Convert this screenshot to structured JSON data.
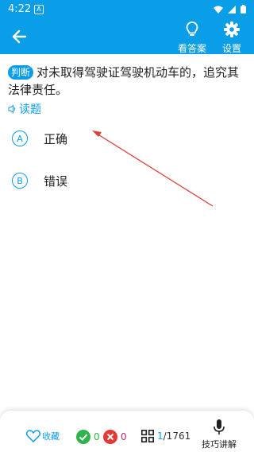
{
  "status_bar": {
    "time": "4:22",
    "notification_glyph": "A"
  },
  "app_bar": {
    "back_icon": "arrow-left-icon",
    "actions": [
      {
        "label": "看答案",
        "icon": "lightbulb-icon"
      },
      {
        "label": "设置",
        "icon": "gear-icon"
      }
    ],
    "background": "#0a9de8"
  },
  "question": {
    "type_badge": "判断",
    "text": "对未取得驾驶证驾驶机动车的，追究其法律责任。",
    "read_label": "读题",
    "options": [
      {
        "letter": "A",
        "text": "正确"
      },
      {
        "letter": "B",
        "text": "错误"
      }
    ]
  },
  "bottom_bar": {
    "favorite_label": "收藏",
    "correct_count": "0",
    "wrong_count": "0",
    "current_index": "1",
    "total": "/1761",
    "tips_label": "技巧讲解"
  },
  "colors": {
    "accent": "#0a9de8",
    "correct": "#2fb34a",
    "wrong": "#e53935",
    "annotation": "#e0403a"
  }
}
